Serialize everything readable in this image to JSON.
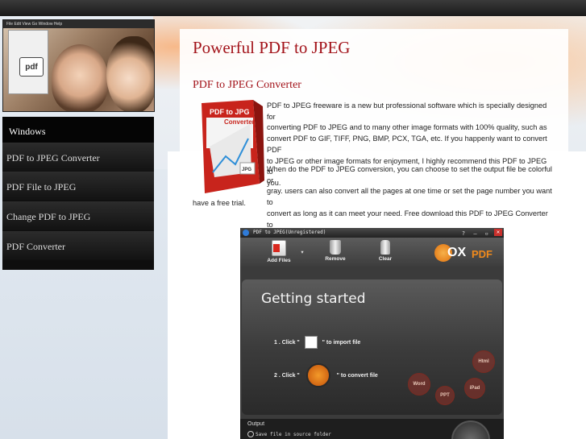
{
  "hero": {
    "menu_text": "File  Edit  View  Go  Window  Help",
    "badge": "pdf"
  },
  "nav": {
    "header": "Windows",
    "items": [
      {
        "label": "PDF to JPEG Converter"
      },
      {
        "label": "PDF File to JPEG"
      },
      {
        "label": "Change PDF to JPEG"
      },
      {
        "label": "PDF Converter"
      }
    ]
  },
  "content": {
    "title": "Powerful PDF to JPEG",
    "subtitle": "PDF to JPEG Converter",
    "boxshot": {
      "line1": "PDF to JPG",
      "line2": "Converter",
      "side": "JPG"
    },
    "paragraph1_lines": [
      "PDF to JPEG freeware is a new but professional software which is specially designed for",
      "converting PDF to JPEG and to many other image formats with 100% quality, such as",
      "convert PDF to GIF, TIFF, PNG, BMP, PCX, TGA, etc. If you happenly want to convert PDF",
      "to JPEG or other image formats for enjoyment, I highly recommend this PDF to JPEG to",
      "you."
    ],
    "paragraph2_lines": [
      "When do the PDF to JPEG conversion, you can choose to set the output file be colorful or",
      "gray. users can also convert all the pages at one time or set the page number you want to",
      "convert as long as it can meet your need. Free download this PDF to JPEG Converter to"
    ],
    "paragraph2_last": "have a free trial."
  },
  "app": {
    "window_title": "PDF to JPEG(Unregistered)",
    "window_controls": "? — ▫",
    "close": "✕",
    "toolbar": [
      {
        "label": "Add Files",
        "icon": "add-files-icon"
      },
      {
        "label": "Remove",
        "icon": "trash-icon"
      },
      {
        "label": "Clear",
        "icon": "clear-icon"
      }
    ],
    "brand": {
      "prefix": "OX",
      "suffix": "PDF"
    },
    "getting_started": "Getting started",
    "step1": {
      "num": "1 .",
      "pre": "Click \"",
      "post": "\" to import file"
    },
    "step2": {
      "num": "2 .",
      "pre": "Click \"",
      "post": "\" to convert file"
    },
    "bubbles": [
      "Word",
      "PPT",
      "iPad",
      "Html"
    ],
    "output_label": "Output",
    "output_option": "Save file in source folder"
  },
  "colors": {
    "accent_red": "#a3141b",
    "nav_bg": "#0e0e0e",
    "brand_orange": "#f08a1c"
  }
}
